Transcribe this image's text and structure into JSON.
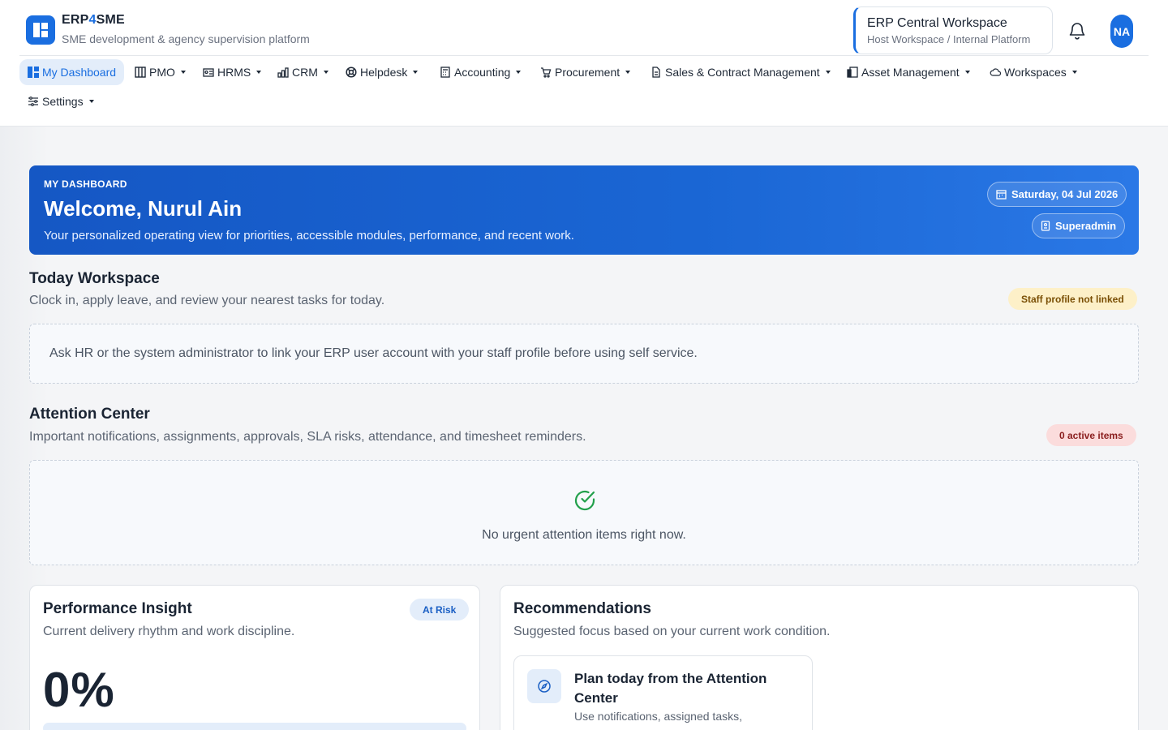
{
  "brand": {
    "name_prefix": "ERP",
    "name_accent": "4",
    "name_suffix": "SME",
    "subtitle": "SME development & agency supervision platform"
  },
  "workspace": {
    "title": "ERP Central Workspace",
    "subtitle": "Host Workspace / Internal Platform"
  },
  "user": {
    "initials": "NA"
  },
  "nav": {
    "items": [
      {
        "label": "My Dashboard",
        "icon": "dashboard-icon",
        "active": true
      },
      {
        "label": "PMO",
        "icon": "kanban-icon"
      },
      {
        "label": "HRMS",
        "icon": "id-card-icon"
      },
      {
        "label": "CRM",
        "icon": "bar-chart-icon"
      },
      {
        "label": "Helpdesk",
        "icon": "lifebuoy-icon"
      },
      {
        "label": "Accounting",
        "icon": "calculator-icon"
      },
      {
        "label": "Procurement",
        "icon": "cart-icon"
      },
      {
        "label": "Sales & Contract Management",
        "icon": "document-icon"
      },
      {
        "label": "Asset Management",
        "icon": "devices-icon"
      },
      {
        "label": "Workspaces",
        "icon": "cloud-icon"
      },
      {
        "label": "Settings",
        "icon": "sliders-icon"
      }
    ]
  },
  "hero": {
    "kicker": "MY DASHBOARD",
    "title": "Welcome, Nurul Ain",
    "description": "Your personalized operating view for priorities, accessible modules, performance, and recent work.",
    "date": "Saturday, 04 Jul 2026",
    "role": "Superadmin"
  },
  "today": {
    "title": "Today Workspace",
    "subtitle": "Clock in, apply leave, and review your nearest tasks for today.",
    "badge": "Staff profile not linked",
    "message": "Ask HR or the system administrator to link your ERP user account with your staff profile before using self service."
  },
  "attention": {
    "title": "Attention Center",
    "subtitle": "Important notifications, assignments, approvals, SLA risks, attendance, and timesheet reminders.",
    "badge": "0 active items",
    "empty_message": "No urgent attention items right now."
  },
  "performance": {
    "title": "Performance Insight",
    "subtitle": "Current delivery rhythm and work discipline.",
    "status": "At Risk",
    "value": "0%",
    "progress": 0
  },
  "recommendations": {
    "title": "Recommendations",
    "subtitle": "Suggested focus based on your current work condition.",
    "items": [
      {
        "title": "Plan today from the Attention Center",
        "description": "Use notifications, assigned tasks,",
        "icon": "compass-icon"
      }
    ]
  },
  "colors": {
    "primary": "#1a6ee0",
    "warning_bg": "#fdf0c8",
    "danger_bg": "#fbdcdc",
    "success": "#22a04b"
  }
}
